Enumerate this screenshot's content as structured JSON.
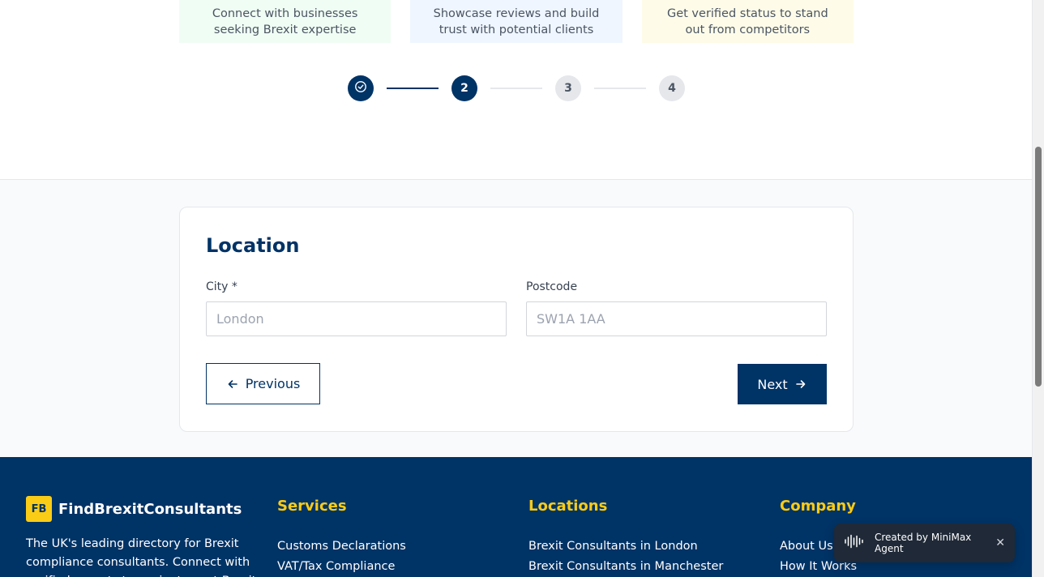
{
  "benefits": [
    {
      "text": "Connect with businesses seeking Brexit expertise"
    },
    {
      "text": "Showcase reviews and build trust with potential clients"
    },
    {
      "text": "Get verified status to stand out from competitors"
    }
  ],
  "stepper": {
    "steps": [
      "1",
      "2",
      "3",
      "4"
    ],
    "current_step": 2,
    "completed_steps": 1
  },
  "form": {
    "title": "Location",
    "city": {
      "label": "City *",
      "placeholder": "London",
      "value": ""
    },
    "postcode": {
      "label": "Postcode",
      "placeholder": "SW1A 1AA",
      "value": ""
    },
    "previous_label": "Previous",
    "next_label": "Next"
  },
  "footer": {
    "logo_text": "FB",
    "brand_name": "FindBrexitConsultants",
    "description": "The UK's leading directory for Brexit compliance consultants. Connect with verified experts to navigate post-Brexit",
    "columns": [
      {
        "heading": "Services",
        "links": [
          "Customs Declarations",
          "VAT/Tax Compliance"
        ]
      },
      {
        "heading": "Locations",
        "links": [
          "Brexit Consultants in London",
          "Brexit Consultants in Manchester"
        ]
      },
      {
        "heading": "Company",
        "links": [
          "About Us",
          "How It Works"
        ]
      }
    ],
    "colors": {
      "background": "#003366",
      "accent": "#facc15"
    }
  },
  "toast": {
    "text": "Created by MiniMax Agent",
    "icon": "waveform-icon",
    "close_icon": "close-icon"
  },
  "theme": {
    "primary": "#003366",
    "muted": "#e5e7eb"
  }
}
